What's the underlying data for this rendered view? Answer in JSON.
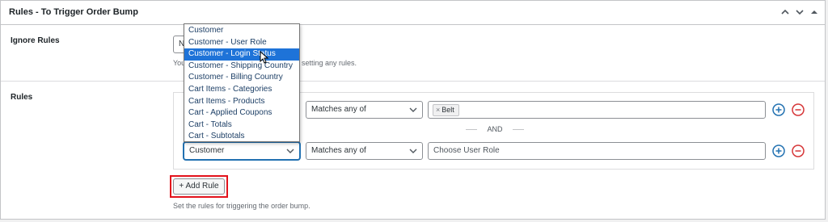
{
  "panel": {
    "title": "Rules - To Trigger Order Bump"
  },
  "ignore_rules": {
    "label": "Ignore Rules",
    "select_value": "N",
    "help_prefix": "You",
    "help_suffix": "setting any rules."
  },
  "rules": {
    "label": "Rules",
    "rows": [
      {
        "operator": "Matches any of",
        "value_tag": "Belt"
      },
      {
        "field": "Customer",
        "operator": "Matches any of",
        "value_placeholder": "Choose User Role"
      }
    ],
    "connector": "AND",
    "add_rule_label": "+ Add Rule",
    "help_text": "Set the rules for triggering the order bump."
  },
  "dropdown": {
    "options": [
      "Customer",
      "Customer - User Role",
      "Customer - Login Status",
      "Customer - Shipping Country",
      "Customer - Billing Country",
      "Cart Items - Categories",
      "Cart Items - Products",
      "Cart - Applied Coupons",
      "Cart - Totals",
      "Cart - Subtotals"
    ],
    "highlighted": "Customer - Login Status"
  },
  "colors": {
    "accent": "#2271b1",
    "add_icon": "#2271b1",
    "remove_icon": "#d63638",
    "highlight_box": "#e3121b",
    "dropdown_selected": "#1e73d8"
  },
  "icons": {
    "collapse_up": "chevron-up-icon",
    "collapse_down": "chevron-down-icon",
    "toggle": "caret-up-icon",
    "add": "plus-circle-icon",
    "remove": "minus-circle-icon"
  }
}
